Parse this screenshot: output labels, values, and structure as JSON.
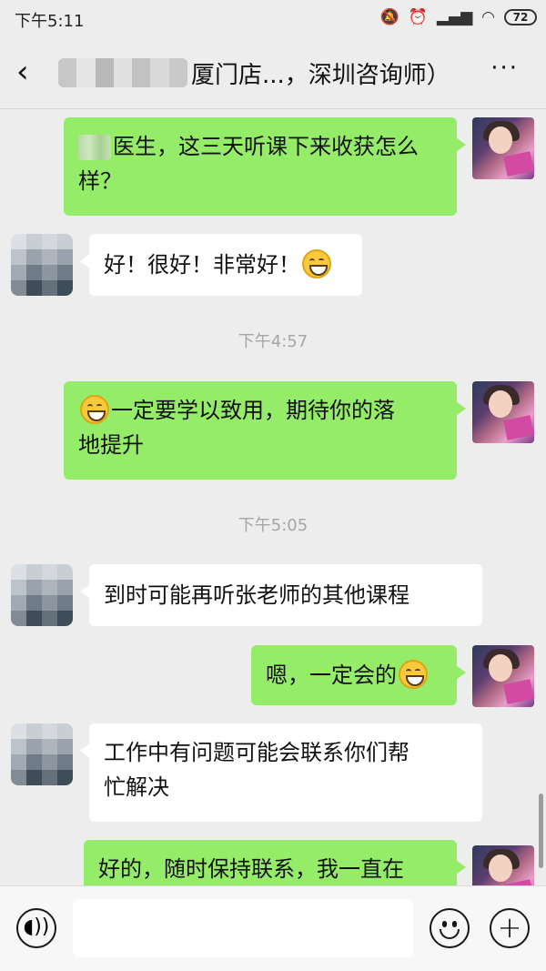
{
  "status_bar": {
    "time": "下午5:11",
    "battery": "72",
    "icons": [
      "mute-icon",
      "alarm-icon",
      "signal-icon",
      "wifi-icon",
      "battery-icon"
    ]
  },
  "header": {
    "title": "厦门店...，深圳咨询师）"
  },
  "messages": [
    {
      "direction": "out",
      "text": "医生，这三天听课下来收获怎么样？",
      "line1": "医生，这三天听课下来收获怎么",
      "line2": "样？"
    },
    {
      "direction": "in",
      "text": "好！很好！非常好！"
    },
    {
      "direction": "out",
      "text": "一定要学以致用，期待你的落地提升",
      "line1": "一定要学以致用，期待你的落",
      "line2": "地提升"
    },
    {
      "direction": "in",
      "text": "到时可能再听张老师的其他课程"
    },
    {
      "direction": "out",
      "text": "嗯，一定会的"
    },
    {
      "direction": "in",
      "text": "工作中有问题可能会联系你们帮忙解决",
      "line1": "工作中有问题可能会联系你们帮",
      "line2": "忙解决"
    },
    {
      "direction": "out",
      "text": "好的，随时保持联系，我一直在"
    }
  ],
  "timestamps": [
    "下午4:57",
    "下午5:05"
  ],
  "colors": {
    "background": "#ededed",
    "outgoing_bubble": "#95ec69",
    "incoming_bubble": "#ffffff",
    "input_bar": "#f7f7f7"
  }
}
